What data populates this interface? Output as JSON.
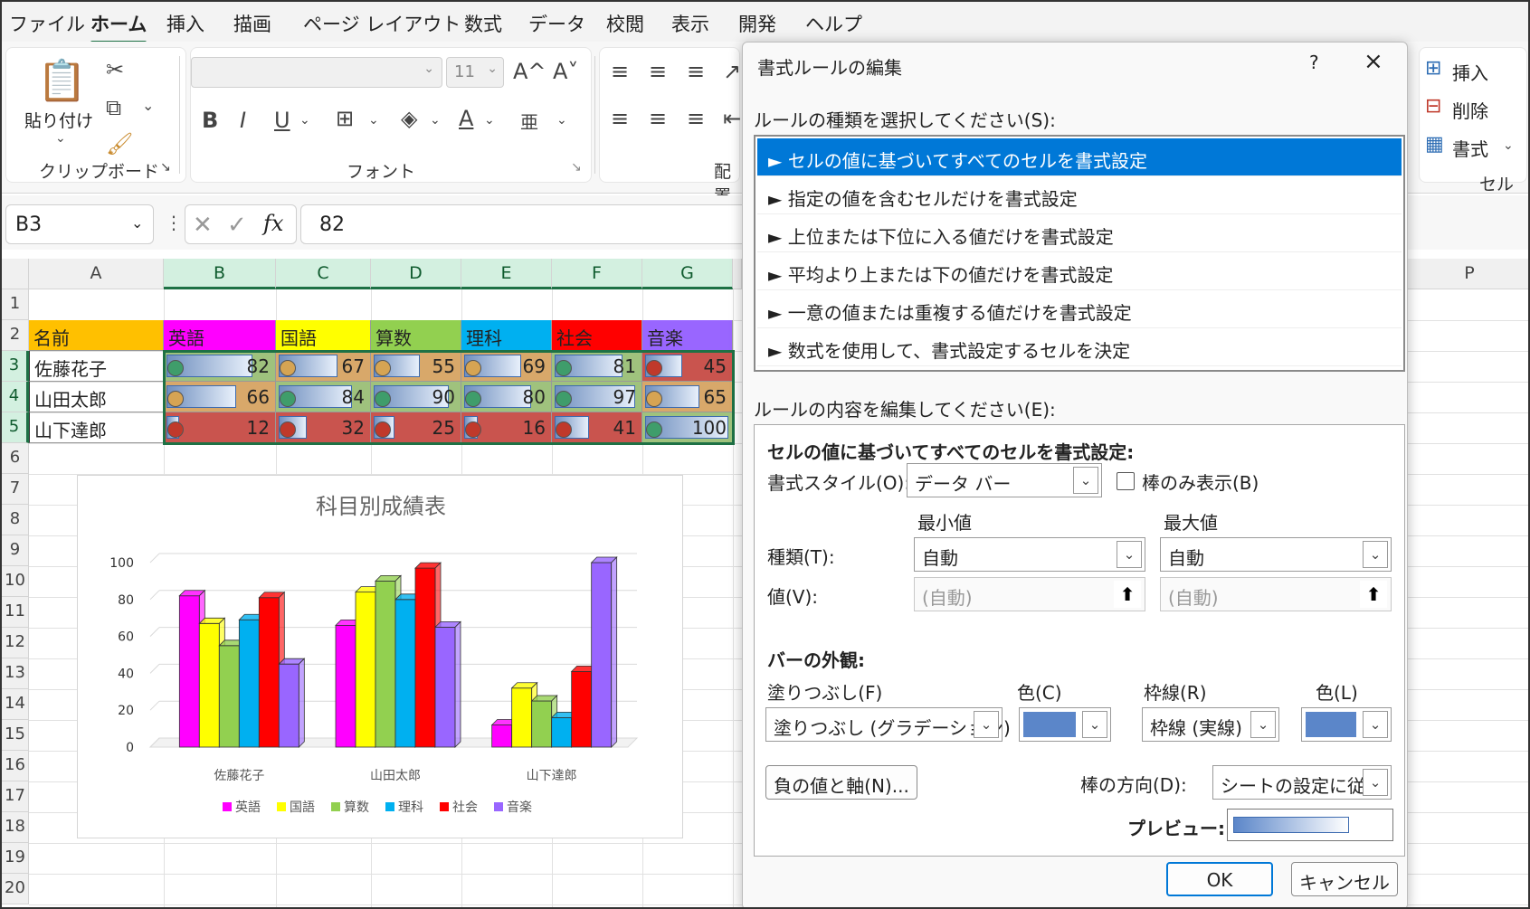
{
  "menu": {
    "tabs": [
      "ファイル",
      "ホーム",
      "挿入",
      "描画",
      "ページ レイアウト",
      "数式",
      "データ",
      "校閲",
      "表示",
      "開発",
      "ヘルプ"
    ],
    "active_index": 1
  },
  "ribbon": {
    "paste_label": "貼り付け",
    "clipboard_label": "クリップボード",
    "font_label": "フォント",
    "font_size": "11",
    "align_label": "配置",
    "cells_label": "セル",
    "cells_insert": "挿入",
    "cells_delete": "削除",
    "cells_format": "書式",
    "bold": "B",
    "italic": "I",
    "underline": "U",
    "font_increase": "A^",
    "font_decrease": "A˅",
    "font_color": "A"
  },
  "formula_bar": {
    "name_box": "B3",
    "fx": "fx",
    "value": "82"
  },
  "sheet": {
    "columns": [
      "A",
      "B",
      "C",
      "D",
      "E",
      "F",
      "G",
      "P"
    ],
    "rows": [
      "1",
      "2",
      "3",
      "4",
      "5",
      "6",
      "7",
      "8",
      "9",
      "10",
      "11",
      "12",
      "13",
      "14",
      "15",
      "16",
      "17",
      "18",
      "19",
      "20"
    ],
    "header_row": [
      "名前",
      "英語",
      "国語",
      "算数",
      "理科",
      "社会",
      "音楽"
    ],
    "data": [
      {
        "name": "佐藤花子",
        "values": [
          82,
          67,
          55,
          69,
          81,
          45
        ]
      },
      {
        "name": "山田太郎",
        "values": [
          66,
          84,
          90,
          80,
          97,
          65
        ]
      },
      {
        "name": "山下達郎",
        "values": [
          12,
          32,
          25,
          16,
          41,
          100
        ]
      }
    ]
  },
  "chart_data": {
    "type": "bar",
    "title": "科目別成績表",
    "categories": [
      "佐藤花子",
      "山田太郎",
      "山下達郎"
    ],
    "series": [
      {
        "name": "英語",
        "values": [
          82,
          66,
          12
        ],
        "color": "#ff00ff"
      },
      {
        "name": "国語",
        "values": [
          67,
          84,
          32
        ],
        "color": "#ffff00"
      },
      {
        "name": "算数",
        "values": [
          55,
          90,
          25
        ],
        "color": "#92d050"
      },
      {
        "name": "理科",
        "values": [
          69,
          80,
          16
        ],
        "color": "#00b0f0"
      },
      {
        "name": "社会",
        "values": [
          81,
          97,
          41
        ],
        "color": "#ff0000"
      },
      {
        "name": "音楽",
        "values": [
          45,
          65,
          100
        ],
        "color": "#9966ff"
      }
    ],
    "ylim": [
      0,
      100
    ],
    "yticks": [
      0,
      20,
      40,
      60,
      80,
      100
    ],
    "grid": true,
    "legend_placement": "bottom"
  },
  "dialog": {
    "title": "書式ルールの編集",
    "help": "?",
    "close": "×",
    "rule_type_label": "ルールの種類を選択してください(S):",
    "rule_types": [
      "► セルの値に基づいてすべてのセルを書式設定",
      "► 指定の値を含むセルだけを書式設定",
      "► 上位または下位に入る値だけを書式設定",
      "► 平均より上または下の値だけを書式設定",
      "► 一意の値または重複する値だけを書式設定",
      "► 数式を使用して、書式設定するセルを決定"
    ],
    "selected_rule_index": 0,
    "edit_label": "ルールの内容を編集してください(E):",
    "edit_title": "セルの値に基づいてすべてのセルを書式設定:",
    "format_style_label": "書式スタイル(O):",
    "format_style_value": "データ バー",
    "bar_only_label": "棒のみ表示(B)",
    "min_label": "最小値",
    "max_label": "最大値",
    "type_label": "種類(T):",
    "min_type": "自動",
    "max_type": "自動",
    "value_label": "値(V):",
    "min_value": "(自動)",
    "max_value": "(自動)",
    "bar_appearance_label": "バーの外観:",
    "fill_label": "塗りつぶし(F)",
    "fill_value": "塗りつぶし (グラデーション)",
    "fill_color_label": "色(C)",
    "border_label": "枠線(R)",
    "border_value": "枠線 (実線)",
    "border_color_label": "色(L)",
    "bar_color": "#5b86c9",
    "negative_button": "負の値と軸(N)...",
    "direction_label": "棒の方向(D):",
    "direction_value": "シートの設定に従う",
    "preview_label": "プレビュー:",
    "ok": "OK",
    "cancel": "キャンセル"
  }
}
